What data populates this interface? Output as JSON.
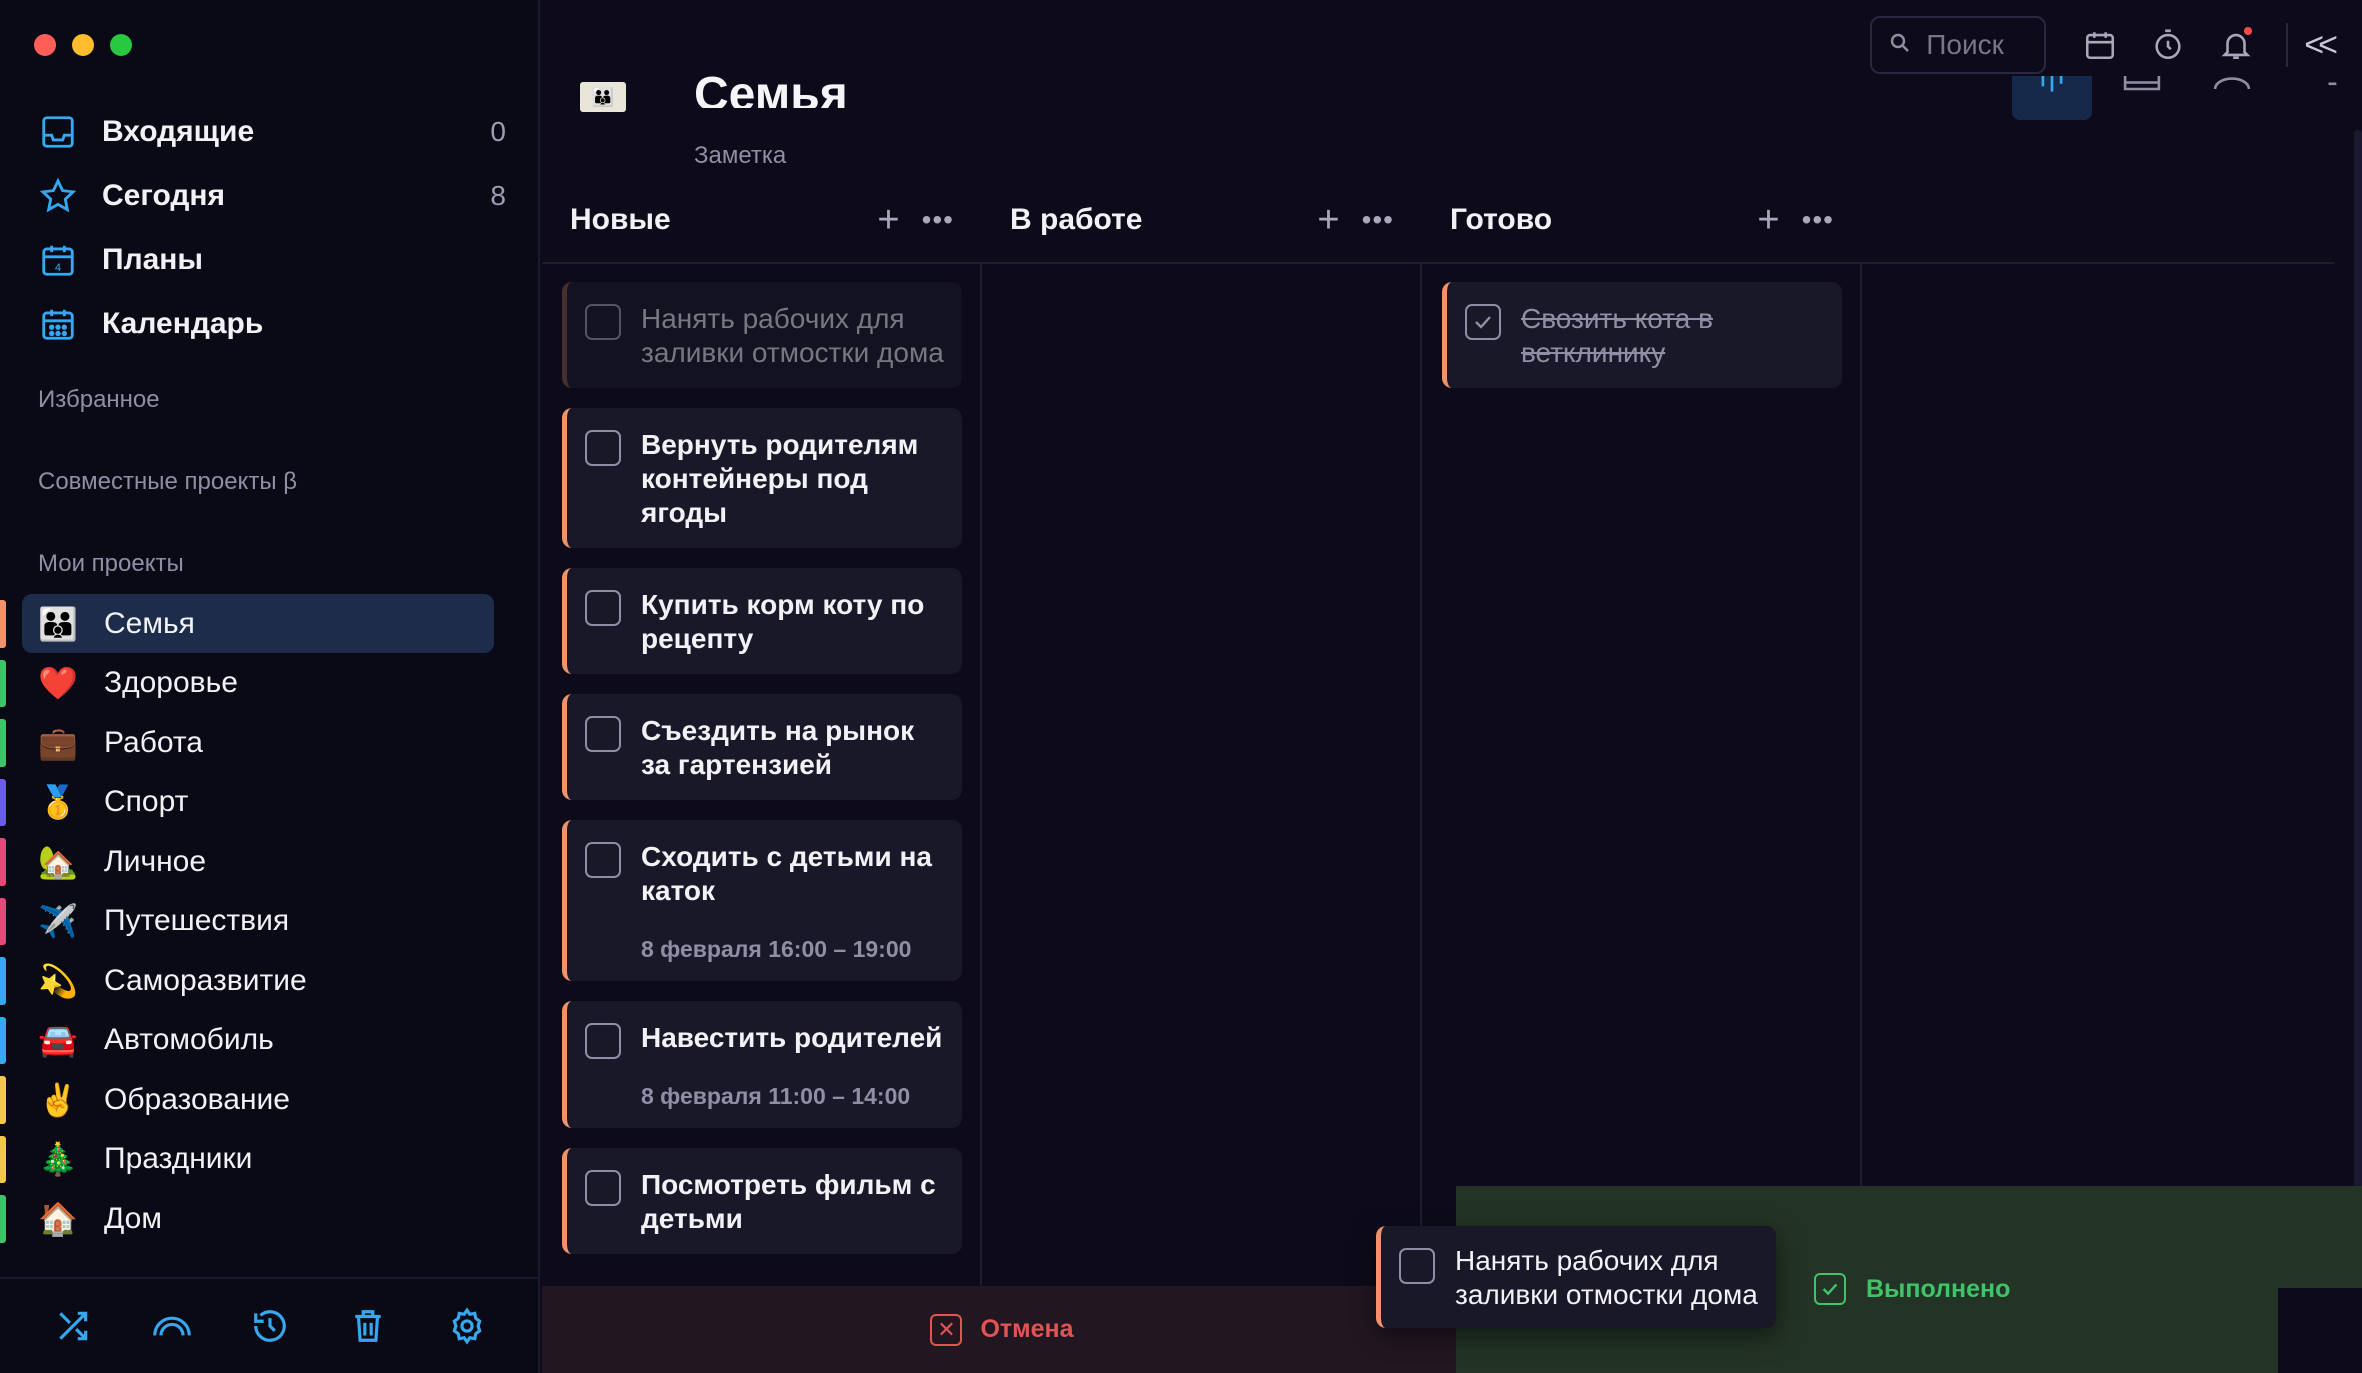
{
  "sidebar": {
    "nav": [
      {
        "label": "Входящие",
        "count": "0",
        "icon": "inbox-icon"
      },
      {
        "label": "Сегодня",
        "count": "8",
        "icon": "star-icon"
      },
      {
        "label": "Планы",
        "count": "",
        "icon": "calendar-day-icon"
      },
      {
        "label": "Календарь",
        "count": "",
        "icon": "calendar-grid-icon"
      }
    ],
    "favorites_title": "Избранное",
    "shared_title": "Совместные проекты β",
    "my_projects_title": "Мои проекты",
    "projects": [
      {
        "label": "Семья",
        "emoji": "👪",
        "color": "#f0936a"
      },
      {
        "label": "Здоровье",
        "emoji": "❤️",
        "color": "#3fc46a"
      },
      {
        "label": "Работа",
        "emoji": "💼",
        "color": "#3fc46a"
      },
      {
        "label": "Спорт",
        "emoji": "🥇",
        "color": "#6b5cf0"
      },
      {
        "label": "Личное",
        "emoji": "🏡",
        "color": "#e8477a"
      },
      {
        "label": "Путешествия",
        "emoji": "✈️",
        "color": "#e8477a"
      },
      {
        "label": "Саморазвитие",
        "emoji": "💫",
        "color": "#35a8f0"
      },
      {
        "label": "Автомобиль",
        "emoji": "🚘",
        "color": "#35a8f0"
      },
      {
        "label": "Образование",
        "emoji": "✌️",
        "color": "#f0c94a"
      },
      {
        "label": "Праздники",
        "emoji": "🎄",
        "color": "#f0c94a"
      },
      {
        "label": "Дом",
        "emoji": "🏠",
        "color": "#3fc46a"
      }
    ],
    "bottom_icons": [
      "shuffle-icon",
      "rainbow-icon",
      "history-icon",
      "trash-icon",
      "settings-icon"
    ]
  },
  "topbar": {
    "search_placeholder": "Поиск",
    "icons": [
      "calendar-icon",
      "timer-icon",
      "bell-icon"
    ],
    "collapse": "<<"
  },
  "page": {
    "title": "Семья",
    "subtitle": "Заметка"
  },
  "columns": [
    {
      "title": "Новые",
      "cards": [
        {
          "text": "Нанять рабочих для заливки отмостки дома",
          "time": "",
          "state": "faded"
        },
        {
          "text": "Вернуть родителям контейнеры под ягоды",
          "time": "",
          "state": "open"
        },
        {
          "text": "Купить корм коту по рецепту",
          "time": "",
          "state": "open"
        },
        {
          "text": "Съездить на рынок за гартензией",
          "time": "",
          "state": "open"
        },
        {
          "text": "Сходить с детьми на каток",
          "time": "8 февраля 16:00 – 19:00",
          "state": "open"
        },
        {
          "text": "Навестить родителей",
          "time": "8 февраля 11:00 – 14:00",
          "state": "open"
        },
        {
          "text": "Посмотреть фильм с детьми",
          "time": "",
          "state": "open"
        }
      ]
    },
    {
      "title": "В работе",
      "cards": []
    },
    {
      "title": "Готово",
      "cards": [
        {
          "text": "Свозить кота в ветклинику",
          "time": "",
          "state": "done"
        }
      ]
    }
  ],
  "drag": {
    "card_text": "Нанять рабочих для заливки отмостки дома",
    "cancel_label": "Отмена",
    "done_label": "Выполнено"
  },
  "colors": {
    "accent": "#35a8f0",
    "cancel": "#e05454",
    "done": "#3fc46a",
    "card_border": "#f0936a"
  }
}
